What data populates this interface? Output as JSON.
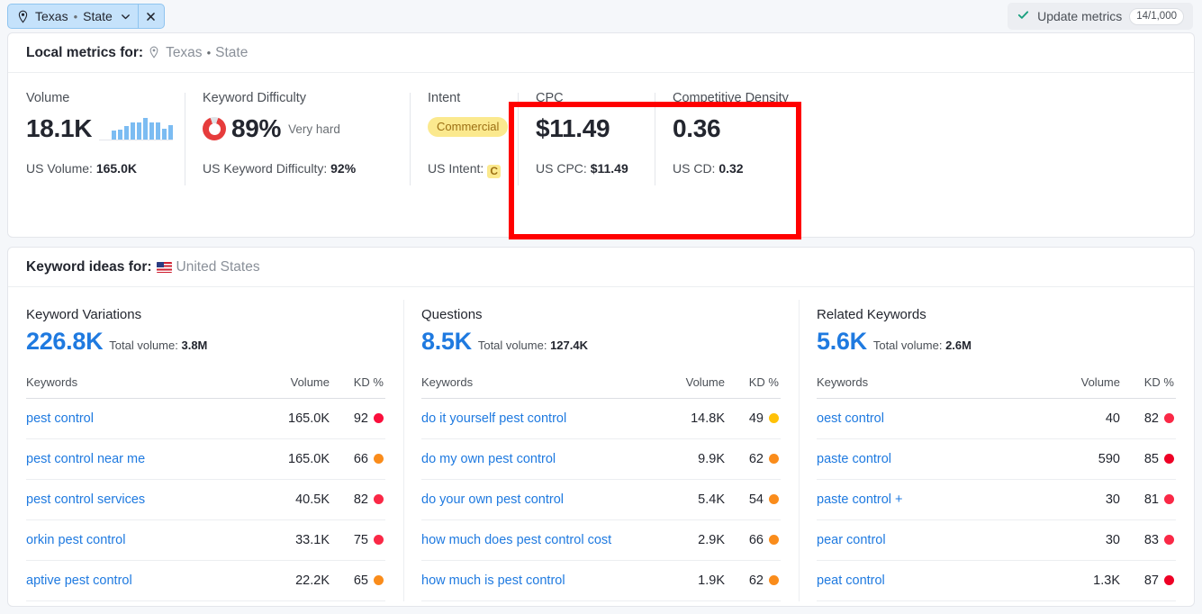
{
  "topbar": {
    "location_chip": {
      "icon": "map-pin-icon",
      "label": "Texas",
      "separator": "•",
      "type": "State",
      "dropdown_icon": "chevron-down-icon",
      "close_icon": "close-icon"
    },
    "update_metrics": {
      "check_icon": "check-icon",
      "label": "Update metrics",
      "quota": "14/1,000"
    }
  },
  "local_metrics": {
    "title": "Local metrics for:",
    "location_icon": "map-pin-icon",
    "location": "Texas",
    "separator": "•",
    "location_type": "State",
    "metrics": [
      {
        "label": "Volume",
        "value": "18.1K",
        "visual": "volume-sparkline",
        "footer_label": "US Volume:",
        "footer_value": "165.0K"
      },
      {
        "label": "Keyword Difficulty",
        "value": "89%",
        "qualifier": "Very hard",
        "visual": "kd-donut",
        "footer_label": "US Keyword Difficulty:",
        "footer_value": "92%"
      },
      {
        "label": "Intent",
        "badge": "Commercial",
        "footer_label": "US Intent:",
        "footer_value": "C"
      },
      {
        "label": "CPC",
        "value": "$11.49",
        "footer_label": "US CPC:",
        "footer_value": "$11.49"
      },
      {
        "label": "Competitive Density",
        "value": "0.36",
        "footer_label": "US CD:",
        "footer_value": "0.32"
      }
    ],
    "sparkline_values": [
      0,
      0,
      38,
      44,
      58,
      74,
      74,
      92,
      74,
      74,
      48,
      62
    ],
    "highlight_color": "#ff0000"
  },
  "keyword_ideas": {
    "title": "Keyword ideas for:",
    "country_flag": "us-flag-icon",
    "country": "United States",
    "columns": [
      {
        "title": "Keyword Variations",
        "count": "226.8K",
        "total_label": "Total volume:",
        "total_value": "3.8M",
        "headers": {
          "keyword": "Keywords",
          "volume": "Volume",
          "kd": "KD %"
        },
        "rows": [
          {
            "keyword": "pest control",
            "volume": "165.0K",
            "kd": "92",
            "kd_color": "#fa0f3c"
          },
          {
            "keyword": "pest control near me",
            "volume": "165.0K",
            "kd": "66",
            "kd_color": "#fa8c1b"
          },
          {
            "keyword": "pest control services",
            "volume": "40.5K",
            "kd": "82",
            "kd_color": "#fa2846"
          },
          {
            "keyword": "orkin pest control",
            "volume": "33.1K",
            "kd": "75",
            "kd_color": "#fa2846"
          },
          {
            "keyword": "aptive pest control",
            "volume": "22.2K",
            "kd": "65",
            "kd_color": "#fa8c1b"
          }
        ]
      },
      {
        "title": "Questions",
        "count": "8.5K",
        "total_label": "Total volume:",
        "total_value": "127.4K",
        "headers": {
          "keyword": "Keywords",
          "volume": "Volume",
          "kd": "KD %"
        },
        "rows": [
          {
            "keyword": "do it yourself pest control",
            "volume": "14.8K",
            "kd": "49",
            "kd_color": "#ffc107"
          },
          {
            "keyword": "do my own pest control",
            "volume": "9.9K",
            "kd": "62",
            "kd_color": "#fa8c1b"
          },
          {
            "keyword": "do your own pest control",
            "volume": "5.4K",
            "kd": "54",
            "kd_color": "#fa8c1b"
          },
          {
            "keyword": "how much does pest control cost",
            "volume": "2.9K",
            "kd": "66",
            "kd_color": "#fa8c1b"
          },
          {
            "keyword": "how much is pest control",
            "volume": "1.9K",
            "kd": "62",
            "kd_color": "#fa8c1b"
          }
        ]
      },
      {
        "title": "Related Keywords",
        "count": "5.6K",
        "total_label": "Total volume:",
        "total_value": "2.6M",
        "headers": {
          "keyword": "Keywords",
          "volume": "Volume",
          "kd": "KD %"
        },
        "rows": [
          {
            "keyword": "oest control",
            "volume": "40",
            "kd": "82",
            "kd_color": "#fa2846"
          },
          {
            "keyword": "paste control",
            "volume": "590",
            "kd": "85",
            "kd_color": "#ee0025"
          },
          {
            "keyword": "paste control +",
            "volume": "30",
            "kd": "81",
            "kd_color": "#fa2846"
          },
          {
            "keyword": "pear control",
            "volume": "30",
            "kd": "83",
            "kd_color": "#fa2846"
          },
          {
            "keyword": "peat control",
            "volume": "1.3K",
            "kd": "87",
            "kd_color": "#ee0025"
          }
        ]
      }
    ]
  }
}
